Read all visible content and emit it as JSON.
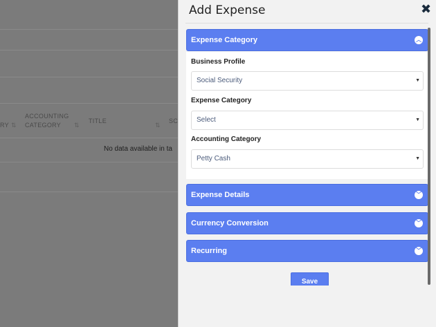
{
  "background": {
    "table": {
      "columns": [
        {
          "label": "RY",
          "sort": "⇅"
        },
        {
          "label": "ACCOUNTING CATEGORY",
          "line1": "ACCOUNTING",
          "line2": "CATEGORY",
          "sort": "⇅"
        },
        {
          "label": "TITLE",
          "sort": "⇅"
        },
        {
          "label": "SC"
        }
      ],
      "empty_message": "No data available in ta"
    }
  },
  "panel": {
    "title": "Add Expense",
    "close_icon": "close-icon",
    "sections": [
      {
        "label": "Expense Category",
        "state": "expanded"
      },
      {
        "label": "Expense Details",
        "state": "collapsed"
      },
      {
        "label": "Currency Conversion",
        "state": "collapsed"
      },
      {
        "label": "Recurring",
        "state": "collapsed"
      }
    ],
    "fields": [
      {
        "label": "Business Profile",
        "value": "Social Security"
      },
      {
        "label": "Expense Category",
        "value": "Select"
      },
      {
        "label": "Accounting Category",
        "value": "Petty Cash"
      }
    ],
    "save_label": "Save"
  },
  "colors": {
    "accent": "#5b7ef0",
    "overlay": "#7b7b7b",
    "panel_bg": "#f2f2f2"
  }
}
